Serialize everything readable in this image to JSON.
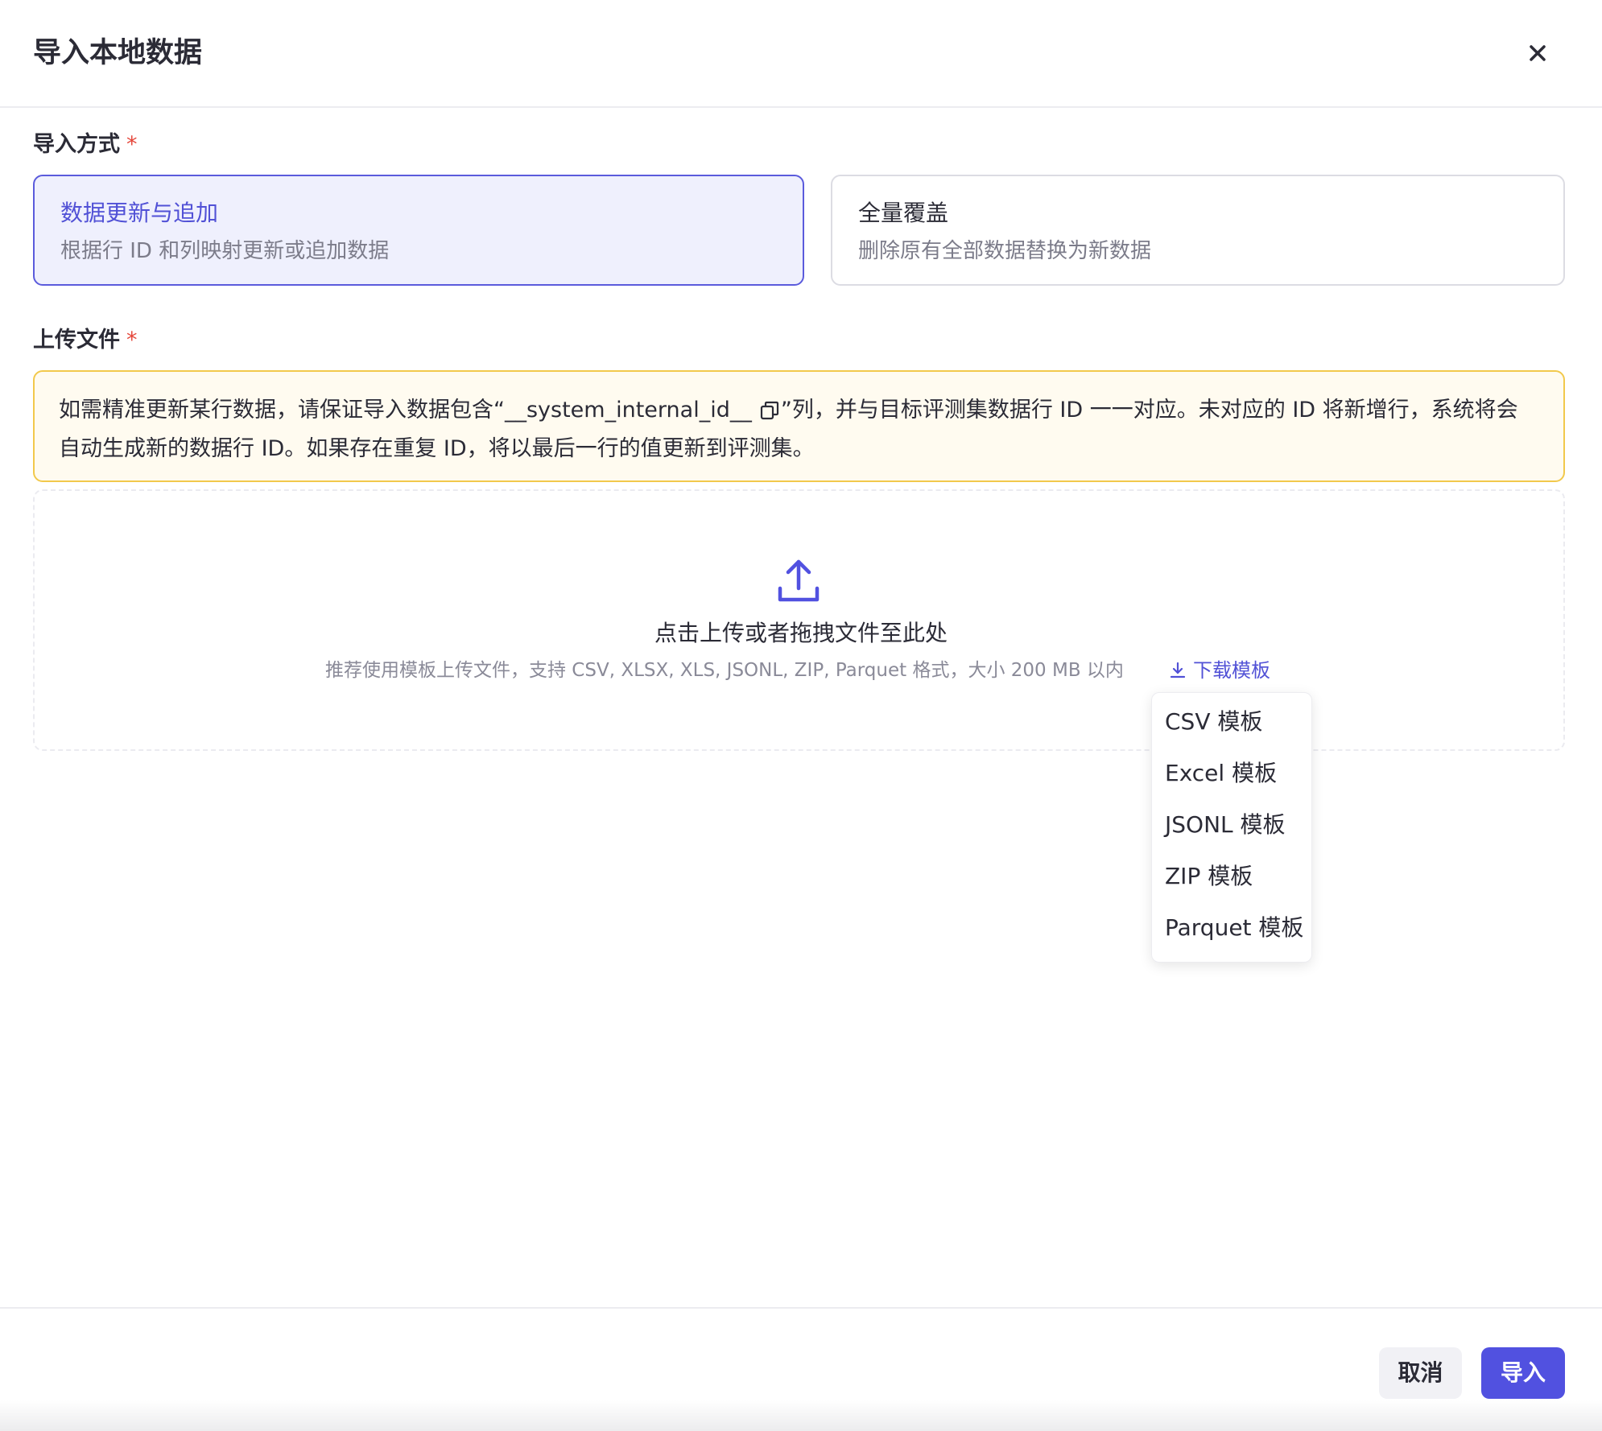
{
  "dialog": {
    "title": "导入本地数据"
  },
  "import_mode": {
    "label": "导入方式",
    "required_mark": "*",
    "options": [
      {
        "title": "数据更新与追加",
        "description": "根据行 ID 和列映射更新或追加数据",
        "selected": true
      },
      {
        "title": "全量覆盖",
        "description": "删除原有全部数据替换为新数据",
        "selected": false
      }
    ]
  },
  "upload": {
    "label": "上传文件",
    "required_mark": "*",
    "notice_before": "如需精准更新某行数据，请保证导入数据包含“__system_internal_id__",
    "notice_after": "”列，并与目标评测集数据行 ID 一一对应。未对应的 ID 将新增行，系统将会自动生成新的数据行 ID。如果存在重复 ID，将以最后一行的值更新到评测集。",
    "dropzone_title": "点击上传或者拖拽文件至此处",
    "dropzone_hint": "推荐使用模板上传文件，支持 CSV, XLSX, XLS, JSONL, ZIP, Parquet 格式，大小 200 MB 以内",
    "download_template_label": "下载模板",
    "template_menu": [
      "CSV 模板",
      "Excel 模板",
      "JSONL 模板",
      "ZIP 模板",
      "Parquet 模板"
    ]
  },
  "footer": {
    "cancel_label": "取消",
    "import_label": "导入"
  },
  "colors": {
    "accent": "#5151e0",
    "selected_bg": "#eff0fd",
    "notice_border": "#f2c94c",
    "required": "#e5483c"
  }
}
